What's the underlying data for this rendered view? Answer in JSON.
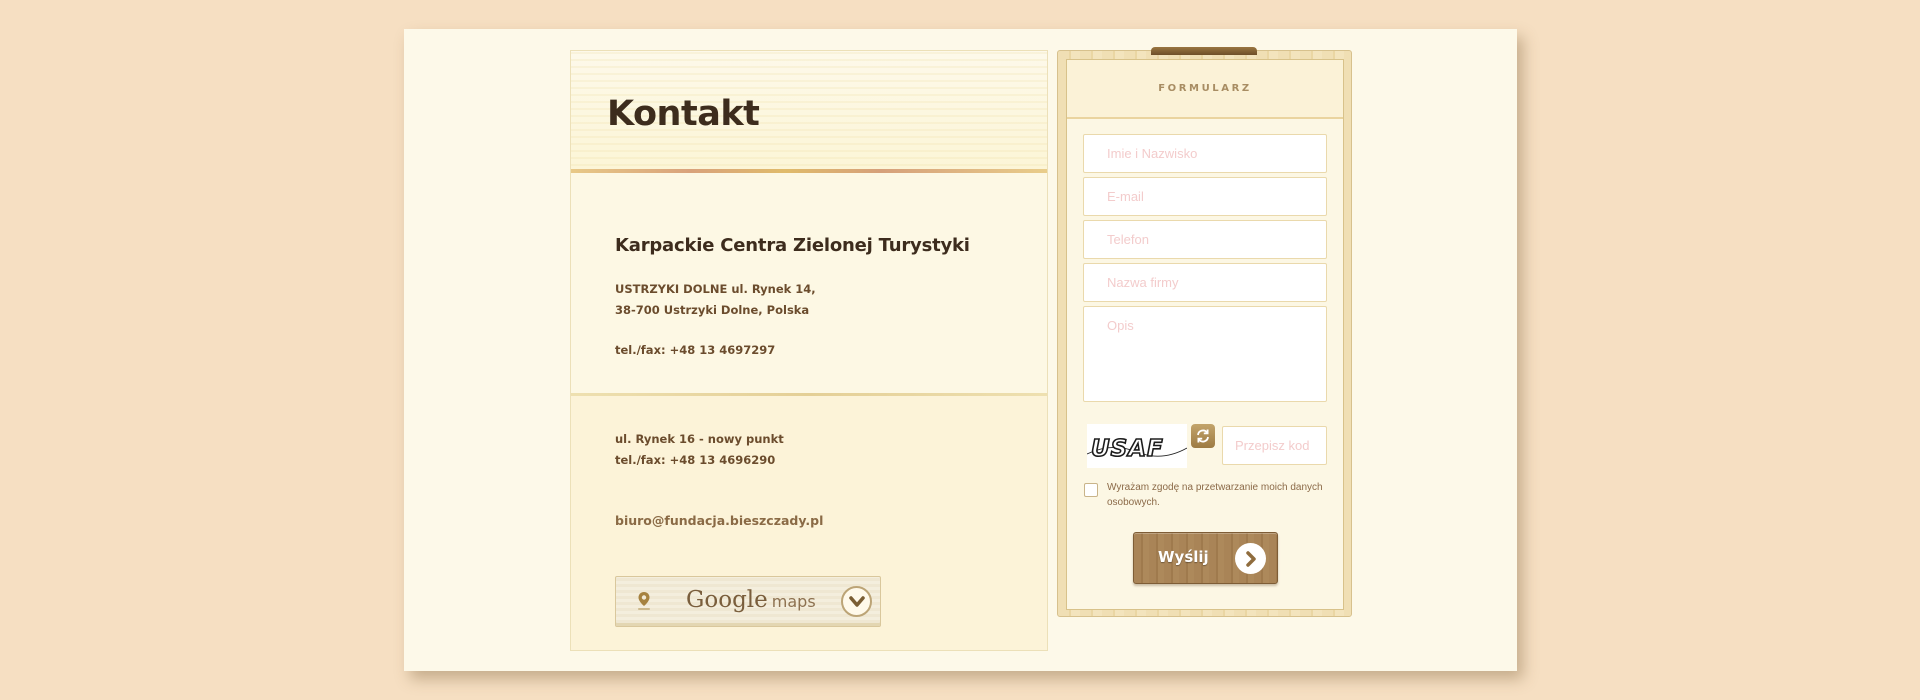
{
  "contact": {
    "title": "Kontakt",
    "company": "Karpackie Centra Zielonej Turystyki",
    "address_line1": "USTRZYKI DOLNE ul. Rynek 14,",
    "address_line2": "38-700 Ustrzyki Dolne, Polska",
    "phone1": "tel./fax: +48 13 4697297",
    "address2_line1": "ul. Rynek 16 - nowy punkt",
    "phone2": "tel./fax: +48 13 4696290",
    "email": "biuro@fundacja.bieszczady.pl",
    "maps_button": {
      "brand": "Google",
      "suffix": "maps",
      "icon": "map-pin-icon",
      "arrow_icon": "chevron-down-icon"
    }
  },
  "form": {
    "title": "FORMULARZ",
    "name_placeholder": "Imie i Nazwisko",
    "email_placeholder": "E-mail",
    "phone_placeholder": "Telefon",
    "company_placeholder": "Nazwa firmy",
    "description_placeholder": "Opis",
    "captcha_text": "USAF",
    "captcha_code_placeholder": "Przepisz kod",
    "refresh_icon": "refresh-icon",
    "consent_text": "Wyrażam zgodę na przetwarzanie moich danych osobowych.",
    "consent_checked": false,
    "submit_label": "Wyślij",
    "submit_icon": "chevron-right-icon"
  },
  "colors": {
    "page_background": "#f6dfc2",
    "sheet_background": "#fdf9e9",
    "heading": "#3d2c1d",
    "body_text": "#6b4c2d",
    "accent_wood": "#a98457",
    "placeholder": "#f3cccc"
  }
}
